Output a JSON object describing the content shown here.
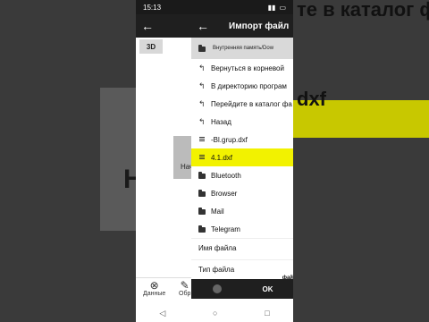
{
  "status_bar": {
    "time": "15:13"
  },
  "background_overlay": {
    "left_text": "H",
    "right_text_1": "те в каталог ф",
    "right_text_2": "dxf"
  },
  "app": {
    "back_glyph": "←",
    "button_3d": "3D",
    "ghost_label": "Нач",
    "bottom_nav": [
      {
        "label": "Данные",
        "icon": "data-icon"
      },
      {
        "label": "Обр",
        "icon": "edit-icon"
      }
    ],
    "nav_bar": {
      "back": "◁",
      "home": "○",
      "recent": "□"
    }
  },
  "dialog": {
    "back_glyph": "←",
    "title": "Импорт файл",
    "path": "Внутренняя память/Dow",
    "items": [
      {
        "label": "Вернуться в корневой",
        "icon": "return-arrow-icon",
        "selected": false
      },
      {
        "label": "В директорию програм",
        "icon": "return-arrow-icon",
        "selected": false
      },
      {
        "label": "Перейдите в каталог фа",
        "icon": "return-arrow-icon",
        "selected": false
      },
      {
        "label": "Назад",
        "icon": "return-arrow-icon",
        "selected": false
      },
      {
        "label": "-Bl.grup.dxf",
        "icon": "file-icon",
        "selected": false
      },
      {
        "label": "4.1.dxf",
        "icon": "file-icon",
        "selected": true
      },
      {
        "label": "Bluetooth",
        "icon": "folder-icon",
        "selected": false
      },
      {
        "label": "Browser",
        "icon": "folder-icon",
        "selected": false
      },
      {
        "label": "Mail",
        "icon": "folder-icon",
        "selected": false
      },
      {
        "label": "Telegram",
        "icon": "folder-icon",
        "selected": false
      }
    ],
    "filename_label": "Имя файла",
    "filetype_label": "Тип файла",
    "filetype_suffix": "фай",
    "ok_label": "OK",
    "selected_color": "#f2f200"
  }
}
